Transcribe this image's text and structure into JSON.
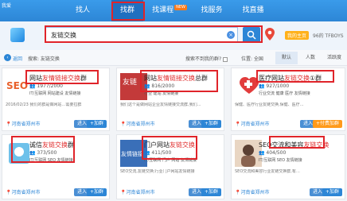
{
  "nav": {
    "logo": "我爱",
    "items": [
      {
        "label": "找人"
      },
      {
        "label": "找群"
      },
      {
        "label": "找课程",
        "badge": "NEW"
      },
      {
        "label": "找服务"
      },
      {
        "label": "找直播"
      }
    ]
  },
  "search": {
    "value": "友链交换",
    "clear": "×"
  },
  "user": {
    "tag": "我的主页",
    "num": "96的 TFBOYS"
  },
  "filter": {
    "back": "返回",
    "query_info": "搜索: 友链交换",
    "hide_full": "搜索不到我的群?",
    "location": "位置: 全国",
    "sort_tabs": [
      "默认",
      "人数",
      "活跃度"
    ]
  },
  "cards": [
    {
      "title_pre": "网站",
      "title_hl": "友情链接交换",
      "title_post": "群",
      "members": "1977/2000",
      "tags": "IT/互联网  网站建设  友情链接",
      "desc": "2016/02/23  我们的群是做网站…需要拉群",
      "loc": "河南省郑州市",
      "btn1": "进入",
      "btn2": "+加群"
    },
    {
      "title_pre": "网站",
      "title_hl": "友情链接交换",
      "title_post": "总群",
      "members": "816/2000",
      "tags": "行业  建站  友情链接",
      "desc": "我们这个是做网站企业友情链接交流群,我们…",
      "loc": "河南省郑州市",
      "btn1": "进入",
      "btn2": "+加群"
    },
    {
      "title_pre": "医疗网站",
      "title_hl": "友链交换",
      "title_post": "①群",
      "members": "927/1000",
      "tags": "行业交流  健康  医疗  友情链接",
      "desc": "保健、医疗行业友链交换,保健、医疗…",
      "loc": "河南省郑州市",
      "btn1": "进入",
      "btn2": "+付费加群"
    },
    {
      "title_pre": "诚信",
      "title_hl": "友链交换",
      "title_post": "群",
      "members": "373/500",
      "tags": "IT/互联网  SEO  友情链接",
      "desc": "",
      "loc": "河南省郑州市",
      "btn1": "进入",
      "btn2": "+加群"
    },
    {
      "title_pre": "门户网站",
      "title_hl": "友链交换",
      "title_post": "",
      "members": "411/500",
      "tags": "IT/互联网  门户  网站  友情链接",
      "desc": "SEO交流,友链交换;行业门户网站友情链接",
      "loc": "河南省郑州市",
      "btn1": "进入",
      "btn2": "+加群"
    },
    {
      "title_pre": "SEO交流和美容",
      "title_hl": "友链交换",
      "title_post": "",
      "members": "404/500",
      "tags": "IT/互联网  SEO  友情链接",
      "desc": "SEO交流和美容行业友链交换群,有…",
      "loc": "河南省郑州市",
      "btn1": "进入",
      "btn2": "+加群"
    }
  ],
  "avatar_texts": [
    "SEO",
    "友链",
    "",
    "",
    "友情链接",
    ""
  ]
}
